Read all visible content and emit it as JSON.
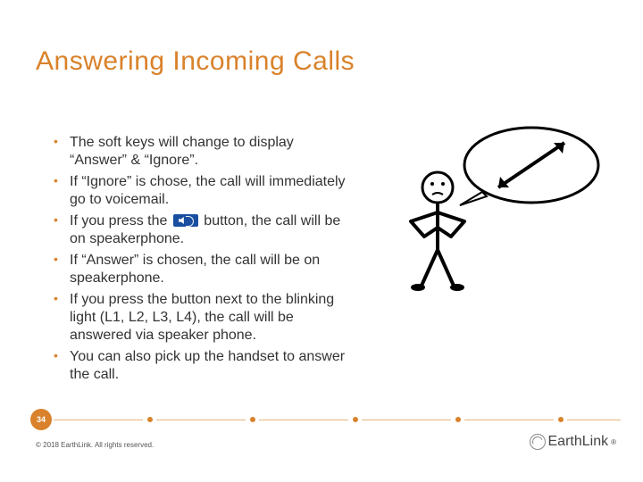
{
  "title": "Answering Incoming Calls",
  "bullets": [
    {
      "pre": "The soft keys will change to display “Answer” & “Ignore”."
    },
    {
      "pre": "If “Ignore” is chose, the call will immediately go to voicemail."
    },
    {
      "pre": "If you press the ",
      "icon": "speaker",
      "post": " button, the call will be on speakerphone."
    },
    {
      "pre": "If “Answer” is chosen, the call will be on speakerphone."
    },
    {
      "pre": "If you press the button next to the blinking light (L1, L2, L3, L4), the call will be answered via speaker phone."
    },
    {
      "pre": "You can also pick up the handset to answer the call."
    }
  ],
  "page_number": "34",
  "copyright": "© 2018 EarthLink. All rights reserved.",
  "logo_text": "EarthLink",
  "logo_reg": "®"
}
